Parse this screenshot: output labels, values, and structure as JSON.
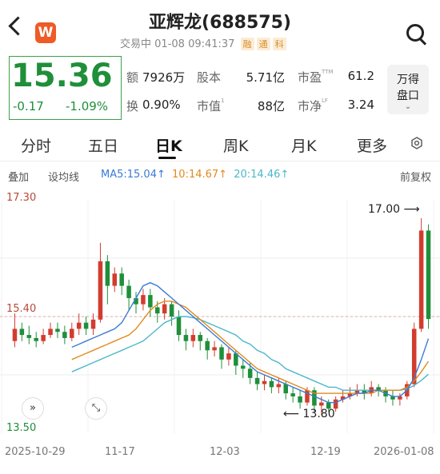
{
  "header": {
    "title": "亚辉龙(688575)",
    "status": "交易中",
    "datetime": "01-08 09:41:37",
    "tags": [
      "融",
      "通",
      "科"
    ],
    "logo_letter": "W"
  },
  "quote": {
    "price": "15.36",
    "change": "-0.17",
    "change_pct": "-1.09%",
    "color_down": "#1f8f3a",
    "color_up": "#d23c2f"
  },
  "stats": {
    "amount_label": "额",
    "amount_value": "7926万",
    "capital_label": "股本",
    "capital_value": "5.71亿",
    "pe_label": "市盈",
    "pe_sup": "TTM",
    "pe_value": "61.2",
    "turnover_label": "换",
    "turnover_value": "0.90%",
    "mcap_label": "市值",
    "mcap_sup": "1",
    "mcap_value": "88亿",
    "pb_label": "市净",
    "pb_sup": "LF",
    "pb_value": "3.24"
  },
  "wande": {
    "line1": "万得",
    "line2": "盘口"
  },
  "tabs": [
    "分时",
    "五日",
    "日K",
    "周K",
    "月K",
    "更多"
  ],
  "active_tab": "日K",
  "indicators": {
    "overlay": "叠加",
    "lines": "设均线",
    "ma5": "MA5:15.04",
    "ma10": "10:14.67",
    "ma20": "20:14.46",
    "adjust": "前复权",
    "ma5_color": "#3a7bd5",
    "ma10_color": "#e08a1e",
    "ma20_color": "#4cb7c9"
  },
  "chart_data": {
    "type": "candlestick",
    "y_top_label": "17.30",
    "y_mid_label": "15.40",
    "y_bottom_label": "13.50",
    "ylim": [
      13.5,
      17.3
    ],
    "high_marker": "17.00",
    "low_marker": "13.80",
    "x_ticks": [
      "2025-10-29",
      "11-17",
      "12-03",
      "12-19",
      "2026-01-08"
    ],
    "candles": [
      [
        15.0,
        15.2,
        15.45,
        14.9
      ],
      [
        15.2,
        15.1,
        15.3,
        15.0
      ],
      [
        15.1,
        15.05,
        15.25,
        14.95
      ],
      [
        15.05,
        15.0,
        15.15,
        14.9
      ],
      [
        15.0,
        15.1,
        15.2,
        14.95
      ],
      [
        15.1,
        15.2,
        15.3,
        15.05
      ],
      [
        15.2,
        15.15,
        15.3,
        15.05
      ],
      [
        15.15,
        15.05,
        15.25,
        14.95
      ],
      [
        15.05,
        15.2,
        15.3,
        15.0
      ],
      [
        15.2,
        15.3,
        15.45,
        15.1
      ],
      [
        15.3,
        15.2,
        15.4,
        15.1
      ],
      [
        15.2,
        15.35,
        15.45,
        15.1
      ],
      [
        15.35,
        16.3,
        16.6,
        15.3
      ],
      [
        16.3,
        15.9,
        16.4,
        15.6
      ],
      [
        15.9,
        16.1,
        16.2,
        15.8
      ],
      [
        16.1,
        15.9,
        16.2,
        15.75
      ],
      [
        15.9,
        15.7,
        16.0,
        15.5
      ],
      [
        15.7,
        15.6,
        15.8,
        15.45
      ],
      [
        15.6,
        15.75,
        15.85,
        15.5
      ],
      [
        15.75,
        15.55,
        15.85,
        15.4
      ],
      [
        15.55,
        15.45,
        15.65,
        15.3
      ],
      [
        15.45,
        15.6,
        15.7,
        15.35
      ],
      [
        15.6,
        15.4,
        15.65,
        15.25
      ],
      [
        15.4,
        15.1,
        15.5,
        15.0
      ],
      [
        15.1,
        15.0,
        15.2,
        14.85
      ],
      [
        15.0,
        15.1,
        15.2,
        14.9
      ],
      [
        15.1,
        15.0,
        15.15,
        14.85
      ],
      [
        15.0,
        14.85,
        15.05,
        14.7
      ],
      [
        14.85,
        14.9,
        15.0,
        14.75
      ],
      [
        14.9,
        14.7,
        14.95,
        14.55
      ],
      [
        14.7,
        14.8,
        14.9,
        14.6
      ],
      [
        14.8,
        14.6,
        14.85,
        14.45
      ],
      [
        14.6,
        14.55,
        14.7,
        14.4
      ],
      [
        14.55,
        14.4,
        14.65,
        14.3
      ],
      [
        14.4,
        14.3,
        14.5,
        14.2
      ],
      [
        14.3,
        14.35,
        14.45,
        14.2
      ],
      [
        14.35,
        14.25,
        14.4,
        14.15
      ],
      [
        14.25,
        14.3,
        14.4,
        14.15
      ],
      [
        14.3,
        14.15,
        14.35,
        14.05
      ],
      [
        14.15,
        14.1,
        14.25,
        14.0
      ],
      [
        14.1,
        14.0,
        14.2,
        13.9
      ],
      [
        14.0,
        14.2,
        14.25,
        13.95
      ],
      [
        14.2,
        13.95,
        14.25,
        13.85
      ],
      [
        13.95,
        14.0,
        14.1,
        13.8
      ],
      [
        14.0,
        13.9,
        14.05,
        13.85
      ],
      [
        13.9,
        14.05,
        14.1,
        13.85
      ],
      [
        14.05,
        14.1,
        14.2,
        14.0
      ],
      [
        14.1,
        14.15,
        14.25,
        14.05
      ],
      [
        14.15,
        14.2,
        14.3,
        14.1
      ],
      [
        14.2,
        14.15,
        14.3,
        14.05
      ],
      [
        14.15,
        14.25,
        14.35,
        14.1
      ],
      [
        14.25,
        14.2,
        14.3,
        14.1
      ],
      [
        14.2,
        14.1,
        14.25,
        14.0
      ],
      [
        14.1,
        14.05,
        14.2,
        13.95
      ],
      [
        14.05,
        14.1,
        14.15,
        13.95
      ],
      [
        14.1,
        14.3,
        14.35,
        14.05
      ],
      [
        14.3,
        15.2,
        15.3,
        14.25
      ],
      [
        15.2,
        16.8,
        17.0,
        15.15
      ],
      [
        16.8,
        15.36,
        16.9,
        15.2
      ]
    ],
    "ma5": [
      14.9,
      14.95,
      15.0,
      15.05,
      15.1,
      15.15,
      15.2,
      15.3,
      15.5,
      15.7,
      15.9,
      15.95,
      15.9,
      15.8,
      15.7,
      15.6,
      15.5,
      15.4,
      15.3,
      15.2,
      15.1,
      15.0,
      14.9,
      14.8,
      14.7,
      14.6,
      14.5,
      14.45,
      14.4,
      14.35,
      14.3,
      14.25,
      14.2,
      14.15,
      14.1,
      14.05,
      14.0,
      14.0,
      14.05,
      14.1,
      14.15,
      14.15,
      14.2,
      14.2,
      14.15,
      14.1,
      14.1,
      14.2,
      14.4,
      14.7,
      15.04
    ],
    "ma10": [
      14.7,
      14.75,
      14.8,
      14.85,
      14.9,
      14.95,
      15.0,
      15.05,
      15.1,
      15.2,
      15.35,
      15.5,
      15.6,
      15.65,
      15.65,
      15.6,
      15.55,
      15.45,
      15.35,
      15.25,
      15.15,
      15.05,
      14.95,
      14.85,
      14.75,
      14.65,
      14.55,
      14.5,
      14.45,
      14.4,
      14.35,
      14.3,
      14.25,
      14.2,
      14.15,
      14.15,
      14.15,
      14.15,
      14.15,
      14.15,
      14.15,
      14.15,
      14.15,
      14.2,
      14.2,
      14.2,
      14.2,
      14.25,
      14.35,
      14.5,
      14.67
    ],
    "ma20": [
      14.5,
      14.55,
      14.6,
      14.65,
      14.7,
      14.75,
      14.8,
      14.85,
      14.9,
      14.95,
      15.0,
      15.1,
      15.2,
      15.3,
      15.35,
      15.4,
      15.4,
      15.38,
      15.35,
      15.3,
      15.25,
      15.2,
      15.15,
      15.1,
      15.0,
      14.95,
      14.85,
      14.8,
      14.7,
      14.65,
      14.55,
      14.5,
      14.45,
      14.4,
      14.35,
      14.3,
      14.25,
      14.25,
      14.2,
      14.2,
      14.2,
      14.2,
      14.2,
      14.2,
      14.2,
      14.2,
      14.2,
      14.22,
      14.28,
      14.36,
      14.46
    ]
  },
  "buttons": {
    "expand": "»",
    "fullscreen": "⤡"
  }
}
